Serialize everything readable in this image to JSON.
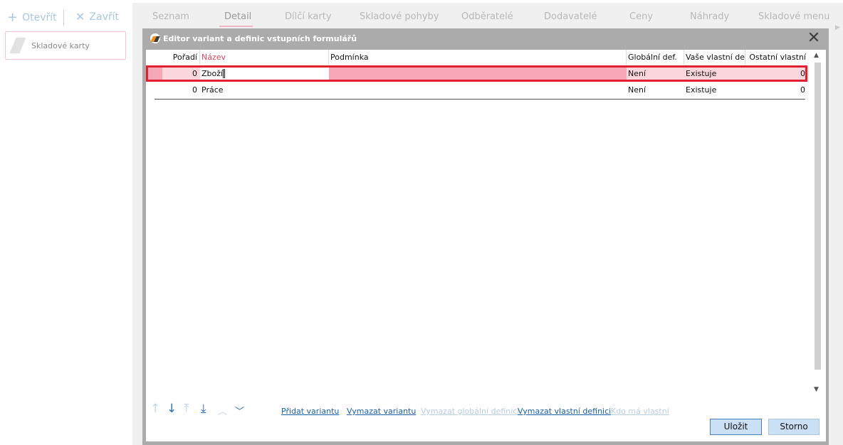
{
  "toolbar": {
    "open_label": "Otevřít",
    "close_label": "Zavřít"
  },
  "sidebar": {
    "card_label": "Skladové karty"
  },
  "tabs": [
    {
      "label": "Seznam"
    },
    {
      "label": "Detail"
    },
    {
      "label": "Dílčí karty"
    },
    {
      "label": "Skladové pohyby"
    },
    {
      "label": "Odběratelé"
    },
    {
      "label": "Dodavatelé"
    },
    {
      "label": "Ceny"
    },
    {
      "label": "Náhrady"
    },
    {
      "label": "Skladové menu"
    }
  ],
  "active_tab": "Detail",
  "dialog": {
    "title": "Editor variant a definic vstupních formulářů",
    "close_glyph": "✕",
    "columns": {
      "order": "Pořadí",
      "name": "Název",
      "condition": "Podmínka",
      "global_def": "Globální def.",
      "own_def": "Vaše vlastní def.",
      "other_own": "Ostatní vlastní"
    },
    "rows": [
      {
        "order": "0",
        "name": "Zboží",
        "condition": "",
        "global_def": "Není",
        "own_def": "Existuje",
        "other_own": "0",
        "selected": true
      },
      {
        "order": "0",
        "name": "Práce",
        "condition": "",
        "global_def": "Není",
        "own_def": "Existuje",
        "other_own": "0",
        "selected": false
      }
    ],
    "nav_icons": [
      {
        "icon": "arrow-up-icon",
        "glyph": "↑",
        "enabled": false
      },
      {
        "icon": "arrow-down-icon",
        "glyph": "↓",
        "enabled": true
      },
      {
        "icon": "arrow-to-top-icon",
        "glyph": "⤒",
        "enabled": false
      },
      {
        "icon": "arrow-to-bottom-icon",
        "glyph": "⤓",
        "enabled": true
      },
      {
        "icon": "chevron-up-icon",
        "glyph": "︿",
        "enabled": false
      },
      {
        "icon": "chevron-down-icon",
        "glyph": "﹀",
        "enabled": true
      }
    ],
    "links": {
      "add_variant": "Přidat variantu",
      "delete_variant": "Vymazat variantu",
      "delete_global": "Vymazat globální definici",
      "delete_own": "Vymazat vlastní definici",
      "who_has_own": "Kdo má vlastní"
    },
    "buttons": {
      "save": "Uložit",
      "cancel": "Storno"
    }
  },
  "colors": {
    "accent": "#e0455d",
    "selection": "#fbd6dd",
    "selection_outline": "#e0202f",
    "link": "#1a5fa8"
  }
}
